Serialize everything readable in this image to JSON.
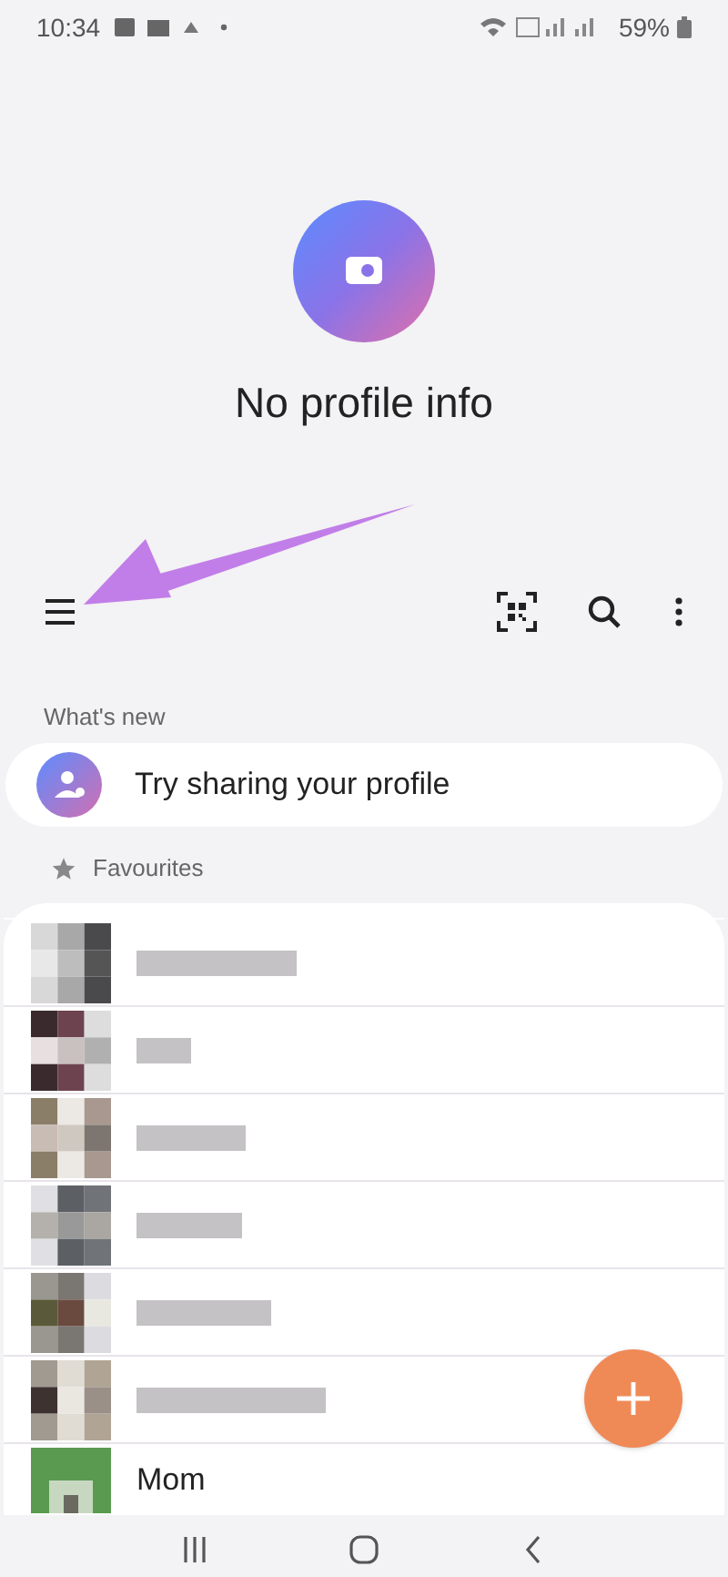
{
  "status_bar": {
    "time": "10:34",
    "battery": "59%"
  },
  "profile": {
    "title": "No profile info"
  },
  "whats_new": {
    "heading": "What's new",
    "item": "Try sharing your profile"
  },
  "favourites": {
    "heading": "Favourites",
    "contacts": [
      {
        "kind": "blurred"
      },
      {
        "kind": "blurred"
      },
      {
        "kind": "blurred"
      },
      {
        "kind": "blurred"
      },
      {
        "kind": "blurred"
      },
      {
        "kind": "blurred"
      },
      {
        "kind": "named",
        "name": "Mom"
      }
    ]
  }
}
